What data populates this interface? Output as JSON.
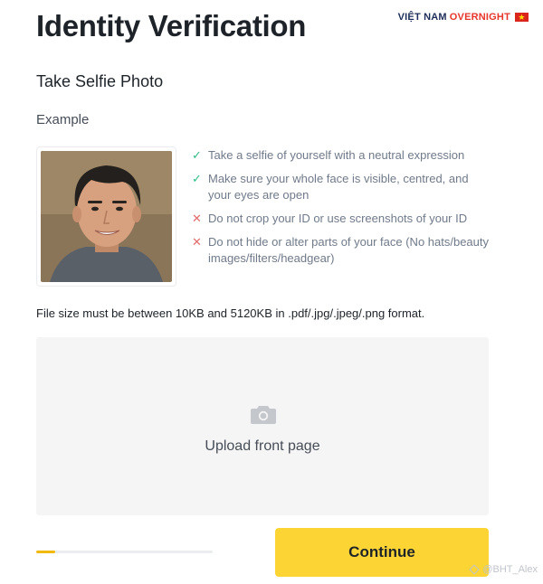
{
  "header": {
    "title": "Identity Verification",
    "brand_part1": "VIỆT NAM",
    "brand_part2": "OVERNIGHT"
  },
  "section": {
    "title": "Take Selfie Photo",
    "example_label": "Example"
  },
  "rules": [
    {
      "type": "ok",
      "icon": "check-icon",
      "text": "Take a selfie of yourself with a neutral expression"
    },
    {
      "type": "ok",
      "icon": "check-icon",
      "text": "Make sure your whole face is visible, centred, and your eyes are open"
    },
    {
      "type": "bad",
      "icon": "cross-icon",
      "text": "Do not crop your ID or use screenshots of your ID"
    },
    {
      "type": "bad",
      "icon": "cross-icon",
      "text": "Do not hide or alter parts of your face (No hats/beauty images/filters/headgear)"
    }
  ],
  "file_note": "File size must be between 10KB and 5120KB in .pdf/.jpg/.jpeg/.png format.",
  "upload": {
    "icon": "camera-icon",
    "label": "Upload front page"
  },
  "progress": {
    "value": 0.11
  },
  "actions": {
    "continue_label": "Continue"
  },
  "watermark": {
    "text": "@BHT_Alex"
  },
  "colors": {
    "accent": "#fcd535",
    "progress": "#f0b90b",
    "ok": "#2ebd85",
    "bad": "#e26b6b",
    "upload_bg": "#f5f5f5"
  }
}
